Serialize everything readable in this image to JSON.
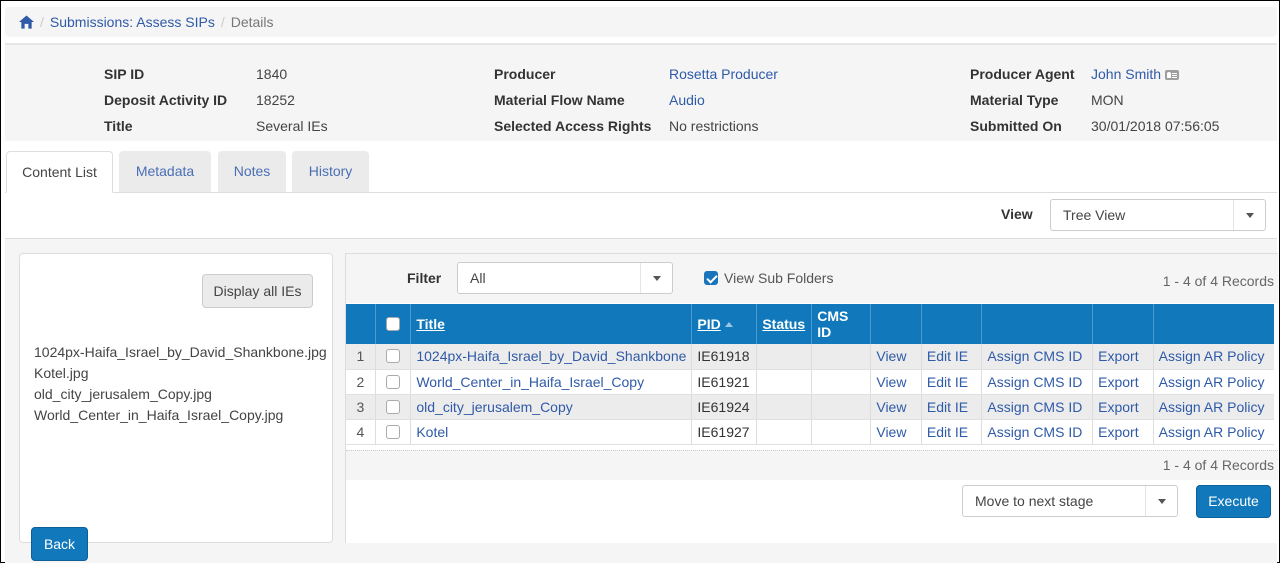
{
  "breadcrumb": {
    "home_icon": "home-icon",
    "items": [
      "Submissions: Assess SIPs",
      "Details"
    ]
  },
  "info": {
    "sip_id": {
      "label": "SIP ID",
      "value": "1840"
    },
    "deposit_activity_id": {
      "label": "Deposit Activity ID",
      "value": "18252"
    },
    "title": {
      "label": "Title",
      "value": "Several IEs"
    },
    "producer": {
      "label": "Producer",
      "value": "Rosetta Producer"
    },
    "material_flow_name": {
      "label": "Material Flow Name",
      "value": "Audio"
    },
    "selected_access_rights": {
      "label": "Selected Access Rights",
      "value": "No restrictions"
    },
    "producer_agent": {
      "label": "Producer Agent",
      "value": "John Smith",
      "icon": "contact-card-icon"
    },
    "material_type": {
      "label": "Material Type",
      "value": "MON"
    },
    "submitted_on": {
      "label": "Submitted On",
      "value": "30/01/2018 07:56:05"
    }
  },
  "tabs": [
    {
      "label": "Content List",
      "active": true
    },
    {
      "label": "Metadata",
      "active": false
    },
    {
      "label": "Notes",
      "active": false
    },
    {
      "label": "History",
      "active": false
    }
  ],
  "view": {
    "label": "View",
    "selected": "Tree View"
  },
  "left_panel": {
    "display_all_label": "Display all IEs",
    "files": [
      "1024px-Haifa_Israel_by_David_Shankbone.jpg",
      "Kotel.jpg",
      "old_city_jerusalem_Copy.jpg",
      "World_Center_in_Haifa_Israel_Copy.jpg"
    ]
  },
  "grid": {
    "filter_label": "Filter",
    "filter_value": "All",
    "view_sub_folders_label": "View Sub Folders",
    "view_sub_folders_checked": true,
    "records_text": "1 - 4 of 4 Records",
    "columns": [
      "",
      "",
      "Title",
      "PID",
      "Status",
      "CMS ID",
      "",
      "",
      "",
      "",
      ""
    ],
    "rows": [
      {
        "num": "1",
        "title": "1024px-Haifa_Israel_by_David_Shankbone",
        "pid": "IE61918",
        "status": "",
        "cms_id": ""
      },
      {
        "num": "2",
        "title": "World_Center_in_Haifa_Israel_Copy",
        "pid": "IE61921",
        "status": "",
        "cms_id": ""
      },
      {
        "num": "3",
        "title": "old_city_jerusalem_Copy",
        "pid": "IE61924",
        "status": "",
        "cms_id": ""
      },
      {
        "num": "4",
        "title": "Kotel",
        "pid": "IE61927",
        "status": "",
        "cms_id": ""
      }
    ],
    "actions": [
      "View",
      "Edit IE",
      "Assign CMS ID",
      "Export",
      "Assign AR Policy"
    ]
  },
  "bottom": {
    "action_select": "Move to next stage",
    "execute_label": "Execute",
    "back_label": "Back"
  }
}
